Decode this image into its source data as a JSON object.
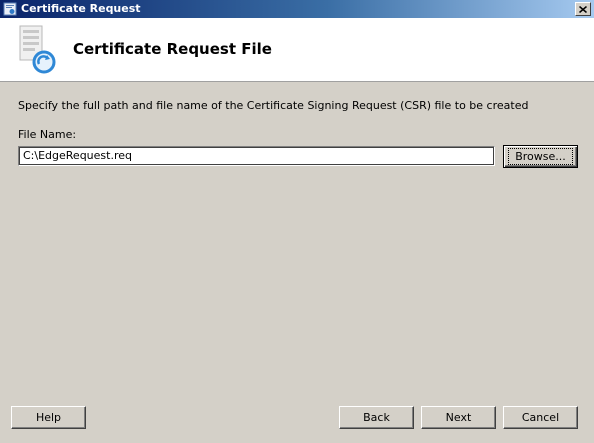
{
  "window": {
    "title": "Certificate Request",
    "icon": "certificate-app-icon",
    "close_icon": "close-icon"
  },
  "header": {
    "title": "Certificate Request File",
    "icon": "certificate-document-icon"
  },
  "body": {
    "instructions": "Specify the full path and file name of the Certificate Signing Request (CSR) file to be created",
    "file_name_label": "File Name:",
    "file_name_value": "C:\\EdgeRequest.req",
    "browse_label": "Browse..."
  },
  "footer": {
    "help_label": "Help",
    "back_label": "Back",
    "next_label": "Next",
    "cancel_label": "Cancel"
  }
}
